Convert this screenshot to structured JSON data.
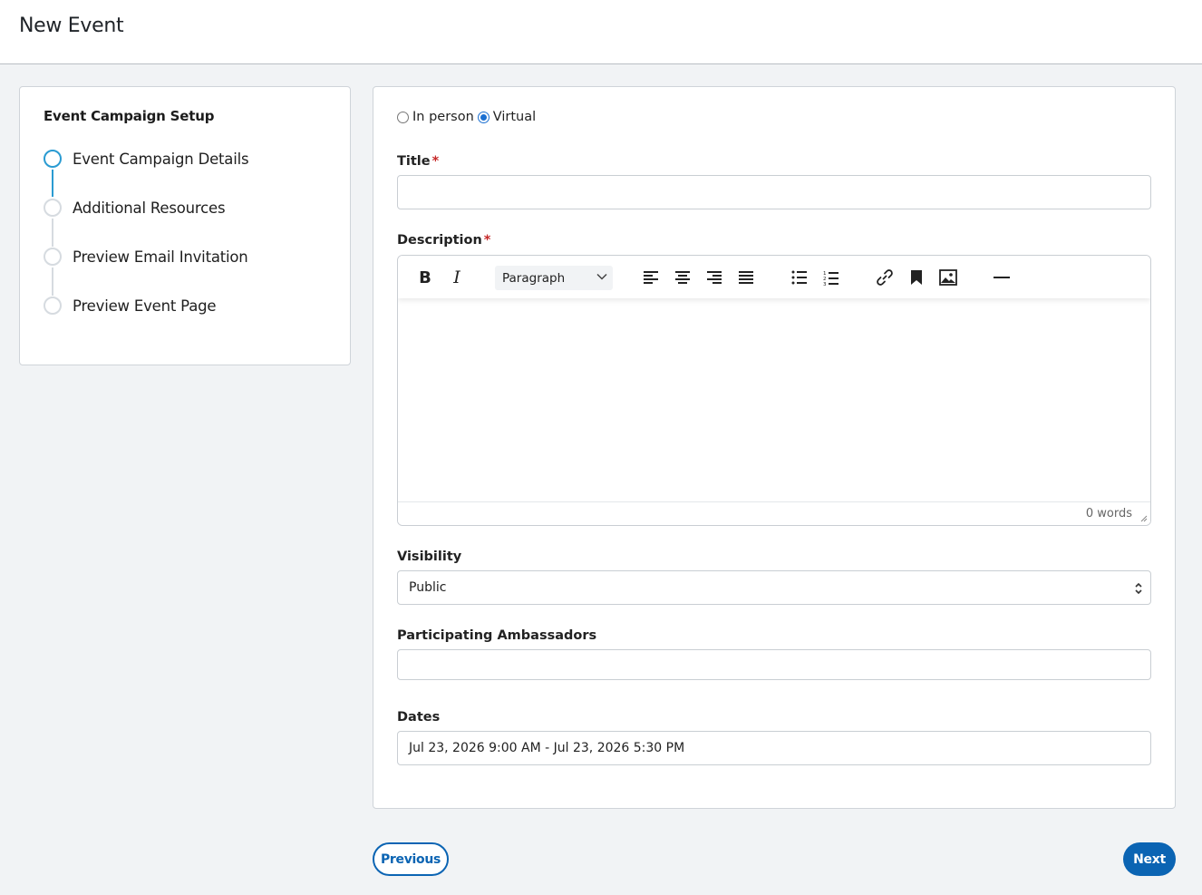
{
  "header": {
    "title": "New Event"
  },
  "steps": {
    "heading": "Event Campaign Setup",
    "items": [
      {
        "label": "Event Campaign Details",
        "active": true
      },
      {
        "label": "Additional Resources",
        "active": false
      },
      {
        "label": "Preview Email Invitation",
        "active": false
      },
      {
        "label": "Preview Event Page",
        "active": false
      }
    ]
  },
  "form": {
    "event_type": {
      "options": [
        "In person",
        "Virtual"
      ],
      "selected": "Virtual"
    },
    "title": {
      "label": "Title",
      "required_mark": "*",
      "value": ""
    },
    "description": {
      "label": "Description",
      "required_mark": "*",
      "block_format": "Paragraph",
      "word_count": "0 words",
      "toolbar_icons": [
        "bold-icon",
        "italic-icon",
        "align-left-icon",
        "align-center-icon",
        "align-right-icon",
        "align-justify-icon",
        "bullet-list-icon",
        "numbered-list-icon",
        "link-icon",
        "bookmark-icon",
        "image-icon",
        "horizontal-rule-icon"
      ],
      "bold_glyph": "B",
      "italic_glyph": "I"
    },
    "visibility": {
      "label": "Visibility",
      "value": "Public"
    },
    "ambassadors": {
      "label": "Participating Ambassadors",
      "value": ""
    },
    "dates": {
      "label": "Dates",
      "value": "Jul 23, 2026 9:00 AM - Jul 23, 2026 5:30 PM"
    }
  },
  "footer": {
    "previous_label": "Previous",
    "next_label": "Next"
  },
  "colors": {
    "accent": "#0b64b3",
    "step_active": "#2a9bd2",
    "required": "#c62828"
  }
}
